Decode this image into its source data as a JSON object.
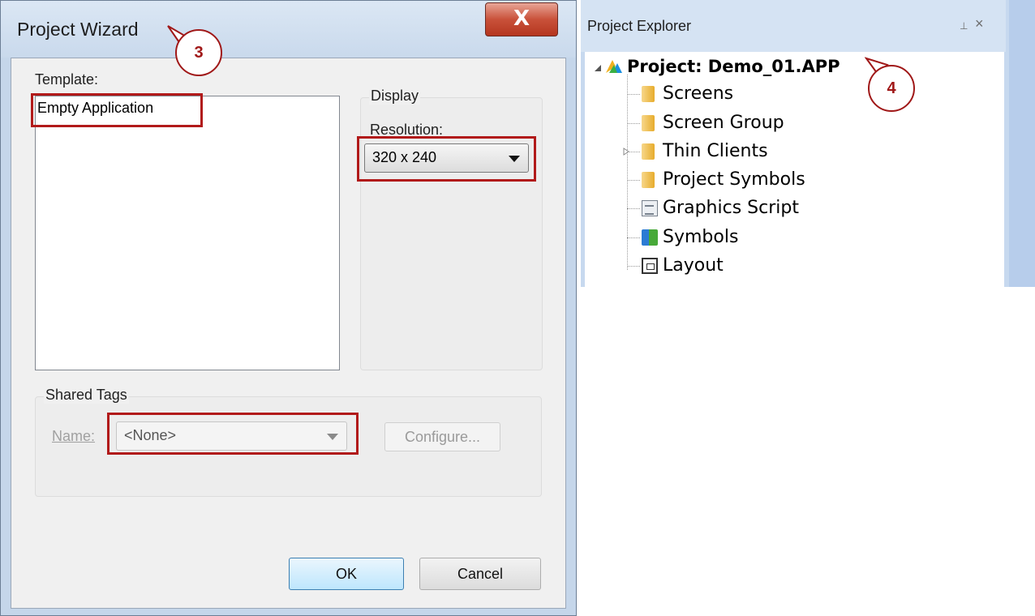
{
  "wizard": {
    "title": "Project Wizard",
    "close_symbol": "X",
    "template_label": "Template:",
    "templates": [
      "Empty Application"
    ],
    "display_group": "Display",
    "resolution_label": "Resolution:",
    "resolution_value": "320 x 240",
    "shared_tags_group": "Shared Tags",
    "name_label": "Name:",
    "name_value": "<None>",
    "configure_button": "Configure...",
    "ok_button": "OK",
    "cancel_button": "Cancel"
  },
  "callouts": {
    "step3": "3",
    "step4": "4"
  },
  "explorer": {
    "title": "Project Explorer",
    "pin_symbol": "⊥",
    "close_symbol": "×",
    "root": "Project: Demo_01.APP",
    "items": [
      {
        "label": "Screens",
        "icon": "folder-icon"
      },
      {
        "label": "Screen Group",
        "icon": "folder-icon"
      },
      {
        "label": "Thin Clients",
        "icon": "folder-icon"
      },
      {
        "label": "Project Symbols",
        "icon": "folder-icon"
      },
      {
        "label": "Graphics Script",
        "icon": "script-icon"
      },
      {
        "label": "Symbols",
        "icon": "symbols-icon"
      },
      {
        "label": "Layout",
        "icon": "layout-icon"
      }
    ]
  },
  "colors": {
    "highlight": "#b11a1a",
    "callout": "#a01818"
  }
}
